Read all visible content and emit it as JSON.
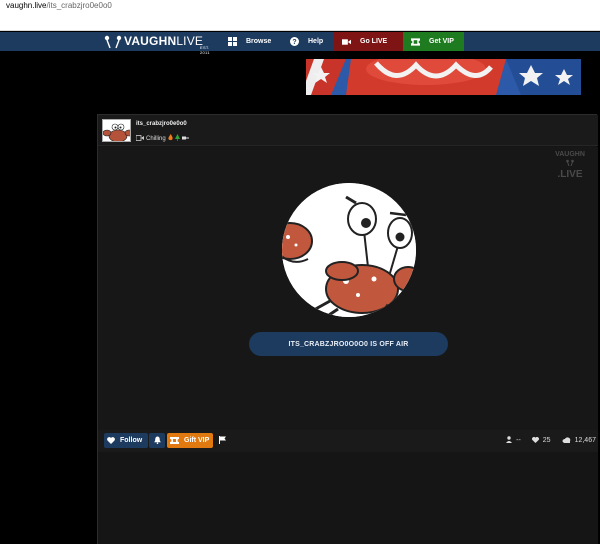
{
  "browser": {
    "url_host": "vaughn.live",
    "url_path": "/its_crabzjro0e0o0"
  },
  "nav": {
    "brand_part1": "VAUGHN",
    "brand_part2": "LIVE",
    "est": "EST. 2011",
    "browse": "Browse",
    "help": "Help",
    "go_live": "Go LIVE",
    "get_vip": "Get VIP",
    "colors": {
      "bar": "#1d3a5f",
      "go_live": "#7e1414",
      "get_vip": "#1f7b20"
    }
  },
  "channel": {
    "name": "its_crabzjro0e0o0",
    "status": "Chilling",
    "status_icon": "camera-icon"
  },
  "player": {
    "watermark_top": "VAUGHN",
    "watermark_bottom": ".LIVE",
    "offair_text": "ITS_CRABZJRO0O0O0 IS OFF AIR"
  },
  "actions": {
    "follow": "Follow",
    "gift_vip": "Gift VIP",
    "colors": {
      "follow": "#1d3a5f",
      "gift": "#e07a10"
    }
  },
  "stats": {
    "viewers": "--",
    "likes": "25",
    "views": "12,467"
  }
}
